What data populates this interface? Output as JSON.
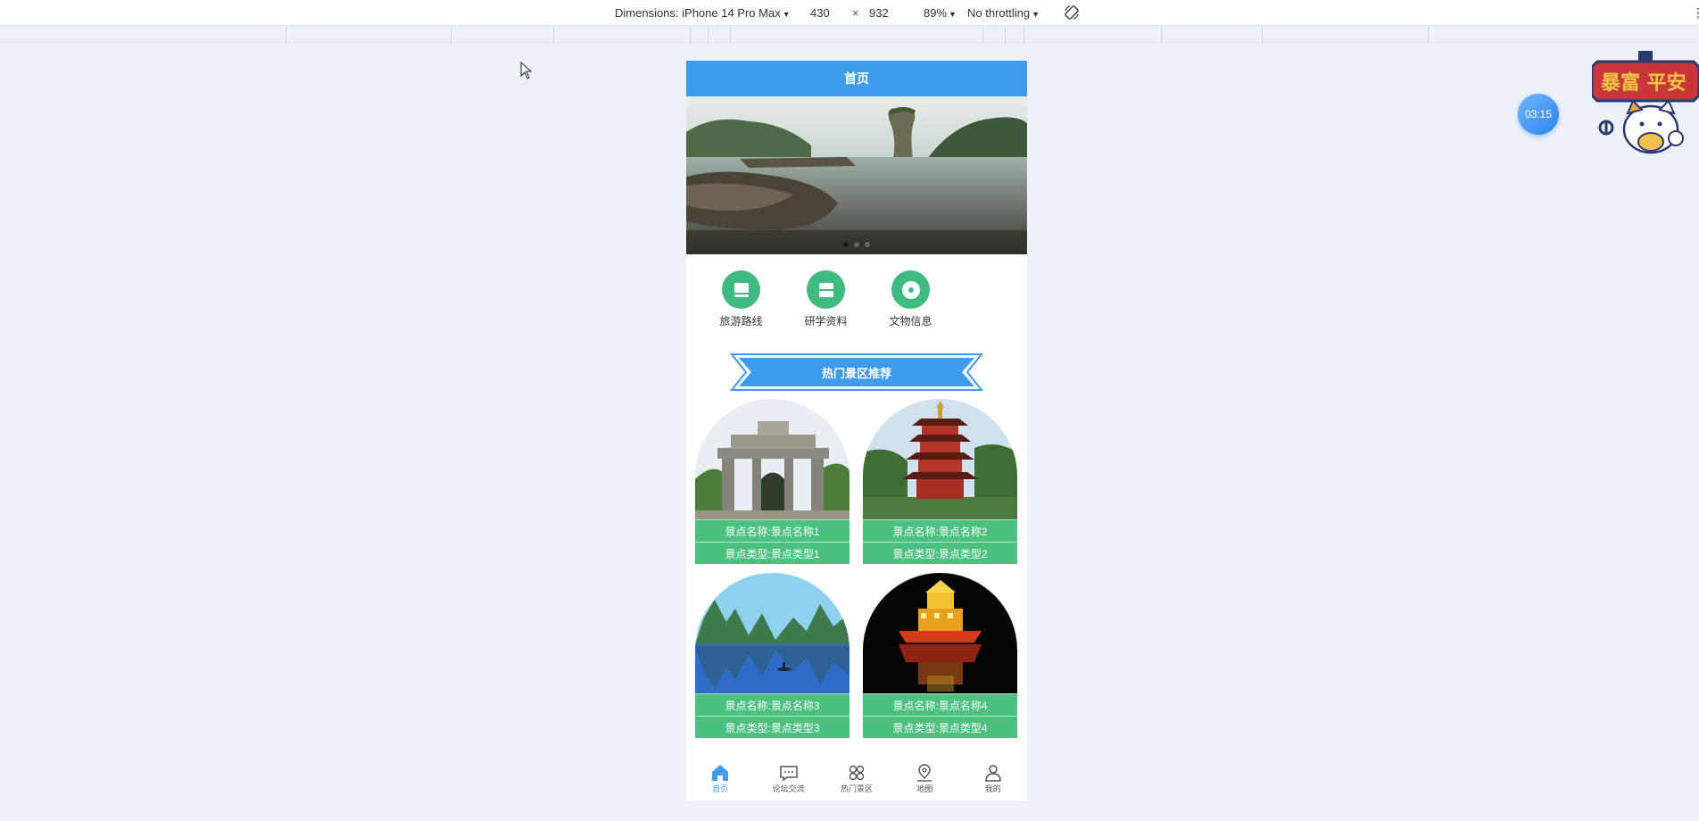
{
  "devtools": {
    "dimensions_label": "Dimensions: iPhone 14 Pro Max",
    "width": "430",
    "times": "×",
    "height": "932",
    "zoom": "89%",
    "throttling": "No throttling"
  },
  "navbar": {
    "title": "首页"
  },
  "banner": {
    "dot_count": 3,
    "active_dot": 0
  },
  "shortcuts": [
    {
      "label": "旅游路线",
      "icon": "monitor-icon"
    },
    {
      "label": "研学资料",
      "icon": "list-icon"
    },
    {
      "label": "文物信息",
      "icon": "disc-icon"
    }
  ],
  "section_title": "热门景区推荐",
  "spots": [
    {
      "name": "景点名称:景点名称1",
      "type": "景点类型:景点类型1",
      "image": "stone-archway"
    },
    {
      "name": "景点名称:景点名称2",
      "type": "景点类型:景点类型2",
      "image": "red-pagoda"
    },
    {
      "name": "景点名称:景点名称3",
      "type": "景点类型:景点类型3",
      "image": "karst-river"
    },
    {
      "name": "景点名称:景点名称4",
      "type": "景点类型:景点类型4",
      "image": "night-boat"
    }
  ],
  "tabs": [
    {
      "label": "首页",
      "icon": "home-icon",
      "active": true
    },
    {
      "label": "论坛交流",
      "icon": "chat-icon",
      "active": false
    },
    {
      "label": "热门景区",
      "icon": "grid-icon",
      "active": false
    },
    {
      "label": "地图",
      "icon": "map-pin-icon",
      "active": false
    },
    {
      "label": "我的",
      "icon": "user-icon",
      "active": false
    }
  ],
  "timer": "03:15",
  "sticker_text": "暴富 平安",
  "colors": {
    "primary": "#3f9cec",
    "green": "#3fba80",
    "card_green": "#4cc17f"
  }
}
